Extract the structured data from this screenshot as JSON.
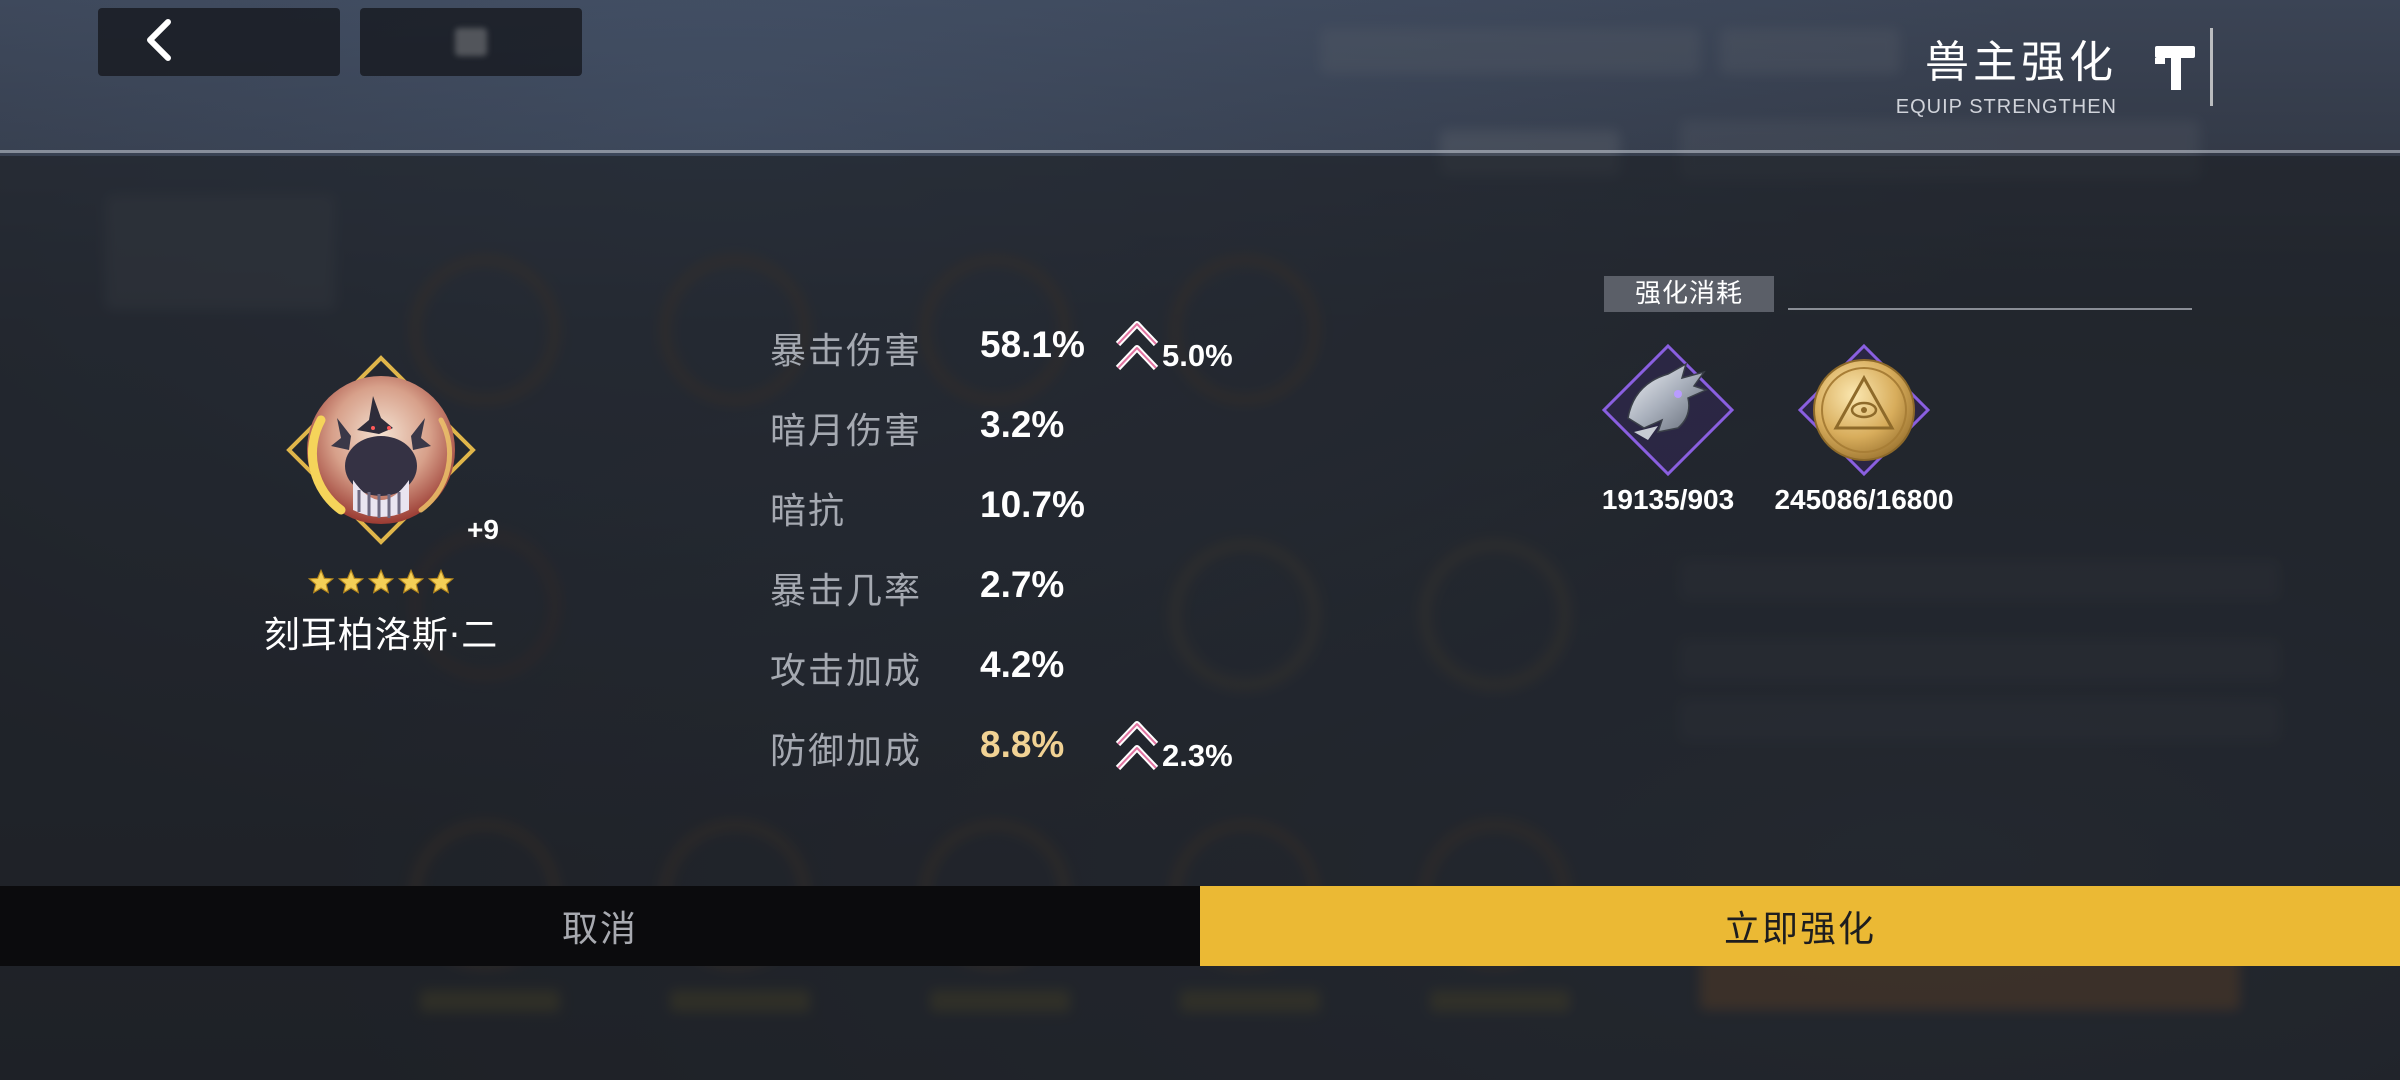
{
  "header": {
    "title": "兽主强化",
    "subtitle": "EQUIP STRENGTHEN",
    "back_icon": "chevron-left-icon",
    "action_icon": "hammer-icon"
  },
  "equipment": {
    "name": "刻耳柏洛斯·二",
    "level": "+9",
    "stars": 5,
    "icon": "cerberus-icon"
  },
  "stats": [
    {
      "label": "暴击伤害",
      "value": "58.1%",
      "increase": "5.0%"
    },
    {
      "label": "暗月伤害",
      "value": "3.2%",
      "increase": null
    },
    {
      "label": "暗抗",
      "value": "10.7%",
      "increase": null
    },
    {
      "label": "暴击几率",
      "value": "2.7%",
      "increase": null
    },
    {
      "label": "攻击加成",
      "value": "4.2%",
      "increase": null
    },
    {
      "label": "防御加成",
      "value": "8.8%",
      "increase": "2.3%",
      "highlight": true
    }
  ],
  "cost": {
    "title": "强化消耗",
    "items": [
      {
        "icon": "dragon-material-icon",
        "count": "19135/903"
      },
      {
        "icon": "gold-coin-icon",
        "count": "245086/16800"
      }
    ]
  },
  "buttons": {
    "cancel": "取消",
    "confirm": "立即强化"
  },
  "colors": {
    "accent": "#ebb934",
    "highlight_value": "#f1d294",
    "gem_purple": "#8a5fe0"
  }
}
